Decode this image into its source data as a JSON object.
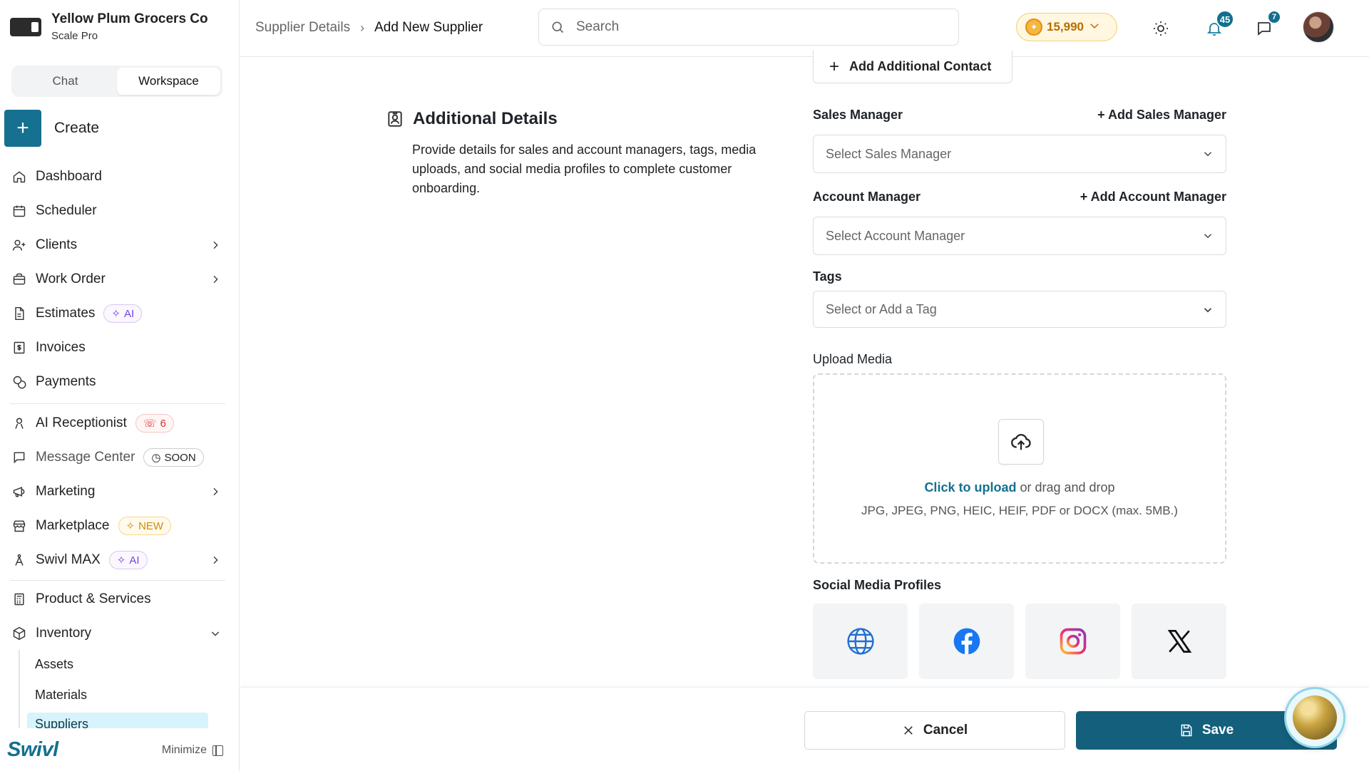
{
  "brand": {
    "name": "Yellow Plum Grocers Co",
    "plan": "Scale Pro"
  },
  "toggle": {
    "chat": "Chat",
    "workspace": "Workspace"
  },
  "create": {
    "label": "Create"
  },
  "nav": {
    "dashboard": "Dashboard",
    "scheduler": "Scheduler",
    "clients": "Clients",
    "work_order": "Work Order",
    "estimates": "Estimates",
    "estimates_badge": "AI",
    "invoices": "Invoices",
    "payments": "Payments",
    "ai_receptionist": "AI Receptionist",
    "ai_receptionist_badge": "6",
    "message_center": "Message Center",
    "message_center_badge": "SOON",
    "marketing": "Marketing",
    "marketplace": "Marketplace",
    "marketplace_badge": "NEW",
    "swivl_max": "Swivl MAX",
    "swivl_max_badge": "AI",
    "products": "Product & Services",
    "inventory": "Inventory",
    "inventory_sub": [
      "Assets",
      "Materials",
      "Suppliers"
    ]
  },
  "sidebar_footer": {
    "logo": "Swivl",
    "minimize": "Minimize"
  },
  "breadcrumb": {
    "parent": "Supplier Details",
    "current": "Add New Supplier"
  },
  "search": {
    "placeholder": "Search"
  },
  "coins": {
    "value": "15,990"
  },
  "notifications": {
    "count": "45"
  },
  "messages": {
    "count": "7"
  },
  "form": {
    "add_contact": "Add Additional Contact",
    "section_title": "Additional Details",
    "section_desc": "Provide details for sales and account managers, tags, media uploads, and social media profiles to complete customer onboarding.",
    "sales_manager_label": "Sales Manager",
    "sales_manager_add": "+ Add Sales Manager",
    "sales_manager_placeholder": "Select Sales Manager",
    "account_manager_label": "Account Manager",
    "account_manager_add": "+ Add Account Manager",
    "account_manager_placeholder": "Select Account Manager",
    "tags_label": "Tags",
    "tags_placeholder": "Select or Add a Tag",
    "upload_label": "Upload Media",
    "upload_link": "Click to upload",
    "upload_rest": " or drag and drop",
    "upload_hint": "JPG, JPEG, PNG, HEIC, HEIF, PDF or DOCX (max. 5MB.)",
    "social_label": "Social Media Profiles",
    "social_icons": [
      "globe-icon",
      "facebook-icon",
      "instagram-icon",
      "x-icon"
    ]
  },
  "footer": {
    "cancel": "Cancel",
    "save": "Save"
  },
  "colors": {
    "primary": "#145f7c",
    "accent": "#12708f",
    "coin": "#f4b740"
  }
}
